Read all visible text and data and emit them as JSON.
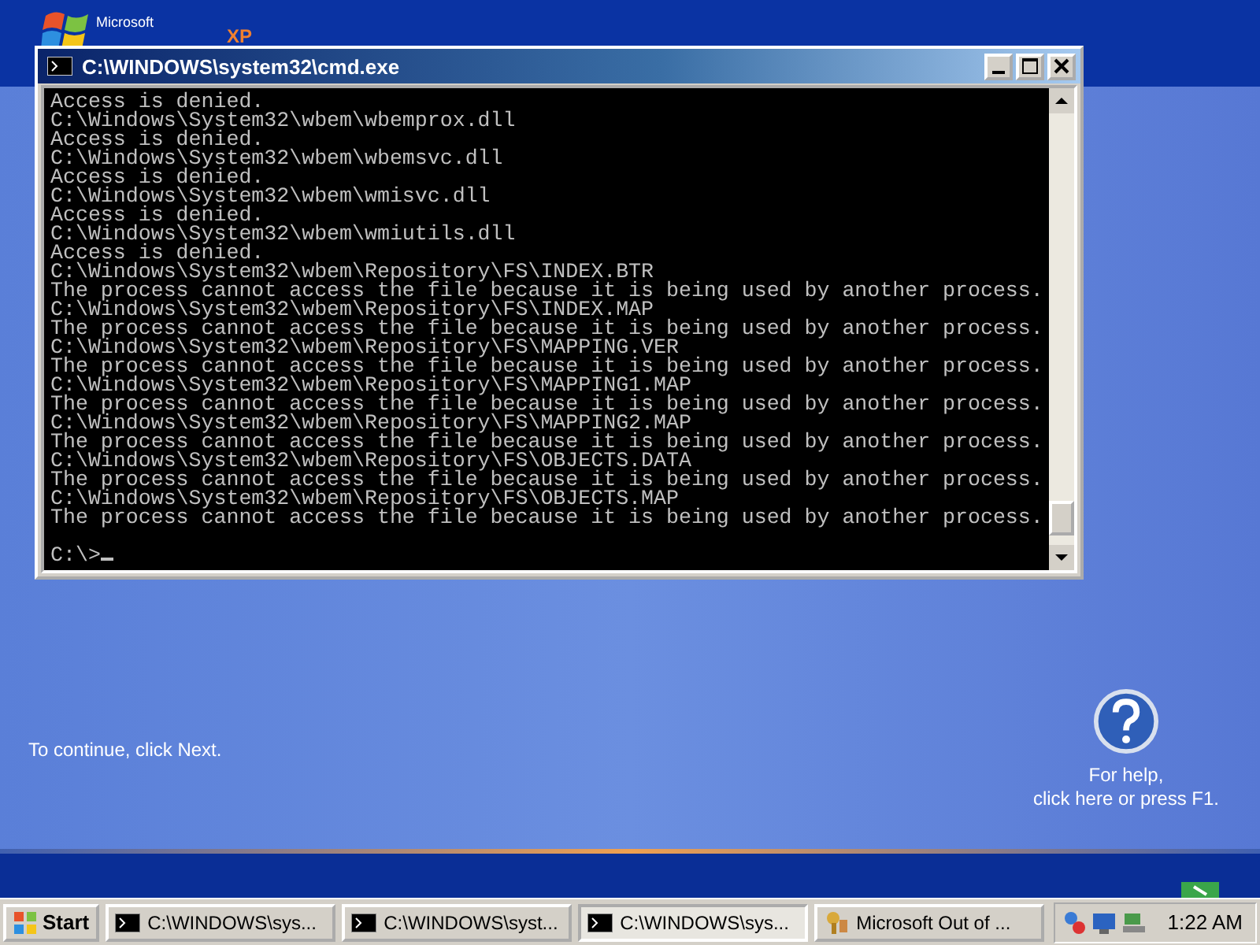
{
  "logo": {
    "maker": "Microsoft",
    "edition": "XP"
  },
  "console": {
    "title": "C:\\WINDOWS\\system32\\cmd.exe",
    "lines": [
      "Access is denied.",
      "C:\\Windows\\System32\\wbem\\wbemprox.dll",
      "Access is denied.",
      "C:\\Windows\\System32\\wbem\\wbemsvc.dll",
      "Access is denied.",
      "C:\\Windows\\System32\\wbem\\wmisvc.dll",
      "Access is denied.",
      "C:\\Windows\\System32\\wbem\\wmiutils.dll",
      "Access is denied.",
      "C:\\Windows\\System32\\wbem\\Repository\\FS\\INDEX.BTR",
      "The process cannot access the file because it is being used by another process.",
      "C:\\Windows\\System32\\wbem\\Repository\\FS\\INDEX.MAP",
      "The process cannot access the file because it is being used by another process.",
      "C:\\Windows\\System32\\wbem\\Repository\\FS\\MAPPING.VER",
      "The process cannot access the file because it is being used by another process.",
      "C:\\Windows\\System32\\wbem\\Repository\\FS\\MAPPING1.MAP",
      "The process cannot access the file because it is being used by another process.",
      "C:\\Windows\\System32\\wbem\\Repository\\FS\\MAPPING2.MAP",
      "The process cannot access the file because it is being used by another process.",
      "C:\\Windows\\System32\\wbem\\Repository\\FS\\OBJECTS.DATA",
      "The process cannot access the file because it is being used by another process.",
      "C:\\Windows\\System32\\wbem\\Repository\\FS\\OBJECTS.MAP",
      "The process cannot access the file because it is being used by another process."
    ],
    "prompt": "C:\\>"
  },
  "setup": {
    "continue_hint": "To continue, click Next.",
    "help": [
      "For help,",
      "click here or press F1."
    ]
  },
  "taskbar": {
    "start": "Start",
    "tasks": [
      {
        "label": "C:\\WINDOWS\\sys...",
        "kind": "console",
        "selected": false
      },
      {
        "label": "C:\\WINDOWS\\syst...",
        "kind": "console",
        "selected": false
      },
      {
        "label": "C:\\WINDOWS\\sys...",
        "kind": "console",
        "selected": true
      },
      {
        "label": "Microsoft Out of ...",
        "kind": "setup",
        "selected": false
      }
    ],
    "clock": "1:22 AM"
  }
}
